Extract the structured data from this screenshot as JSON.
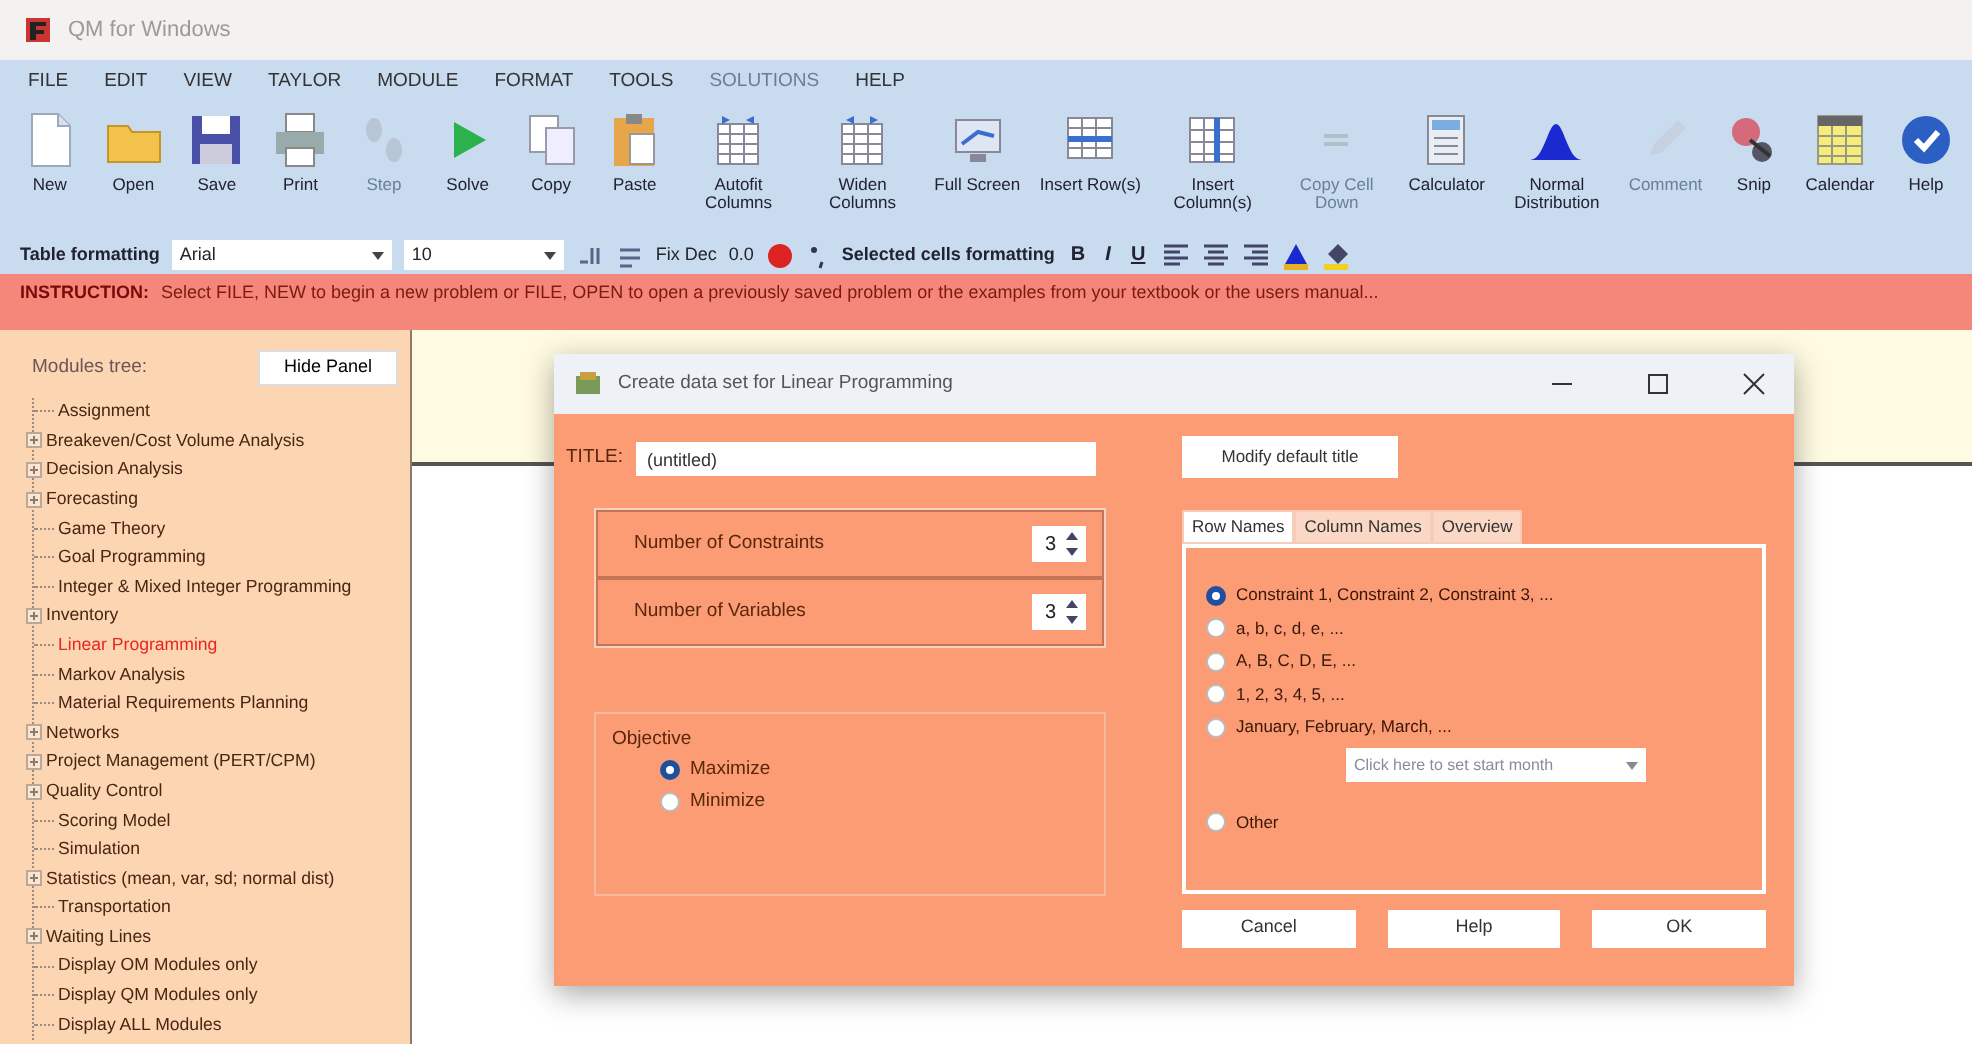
{
  "window": {
    "title": "QM for Windows"
  },
  "menu": [
    {
      "label": "FILE",
      "disabled": false
    },
    {
      "label": "EDIT",
      "disabled": false
    },
    {
      "label": "VIEW",
      "disabled": false
    },
    {
      "label": "TAYLOR",
      "disabled": false
    },
    {
      "label": "MODULE",
      "disabled": false
    },
    {
      "label": "FORMAT",
      "disabled": false
    },
    {
      "label": "TOOLS",
      "disabled": false
    },
    {
      "label": "SOLUTIONS",
      "disabled": true
    },
    {
      "label": "HELP",
      "disabled": false
    }
  ],
  "toolbar": [
    {
      "label": "New",
      "disabled": false
    },
    {
      "label": "Open",
      "disabled": false
    },
    {
      "label": "Save",
      "disabled": false
    },
    {
      "label": "Print",
      "disabled": false
    },
    {
      "label": "Step",
      "disabled": true
    },
    {
      "label": "Solve",
      "disabled": false
    },
    {
      "label": "Copy",
      "disabled": false
    },
    {
      "label": "Paste",
      "disabled": false
    },
    {
      "label": "Autofit Columns",
      "disabled": false
    },
    {
      "label": "Widen Columns",
      "disabled": false
    },
    {
      "label": "Full Screen",
      "disabled": false
    },
    {
      "label": "Insert Row(s)",
      "disabled": false
    },
    {
      "label": "Insert Column(s)",
      "disabled": false
    },
    {
      "label": "Copy Cell Down",
      "disabled": true
    },
    {
      "label": "Calculator",
      "disabled": false
    },
    {
      "label": "Normal Distribution",
      "disabled": false
    },
    {
      "label": "Comment",
      "disabled": true
    },
    {
      "label": "Snip",
      "disabled": false
    },
    {
      "label": "Calendar",
      "disabled": false
    },
    {
      "label": "Help",
      "disabled": false
    }
  ],
  "format_bar": {
    "label": "Table formatting",
    "font": "Arial",
    "size": "10",
    "fix_dec": "Fix Dec",
    "decimals": "0.0",
    "selected_label": "Selected cells formatting",
    "bold": "B",
    "italic": "I",
    "underline": "U"
  },
  "instruction": {
    "label": "INSTRUCTION:",
    "text": "Select FILE, NEW to begin a new problem or FILE, OPEN to open a previously saved problem or the examples from your textbook or the users manual..."
  },
  "modules_panel": {
    "label": "Modules tree:",
    "hide_button": "Hide Panel",
    "items": [
      {
        "label": "Assignment",
        "kind": "leaf",
        "selected": false
      },
      {
        "label": "Breakeven/Cost Volume Analysis",
        "kind": "group",
        "selected": false
      },
      {
        "label": "Decision Analysis",
        "kind": "group",
        "selected": false
      },
      {
        "label": "Forecasting",
        "kind": "group",
        "selected": false
      },
      {
        "label": "Game Theory",
        "kind": "leaf",
        "selected": false
      },
      {
        "label": "Goal Programming",
        "kind": "leaf",
        "selected": false
      },
      {
        "label": "Integer & Mixed Integer Programming",
        "kind": "leaf",
        "selected": false
      },
      {
        "label": "Inventory",
        "kind": "group",
        "selected": false
      },
      {
        "label": "Linear Programming",
        "kind": "leaf",
        "selected": true
      },
      {
        "label": "Markov Analysis",
        "kind": "leaf",
        "selected": false
      },
      {
        "label": "Material Requirements Planning",
        "kind": "leaf",
        "selected": false
      },
      {
        "label": "Networks",
        "kind": "group",
        "selected": false
      },
      {
        "label": "Project Management (PERT/CPM)",
        "kind": "group",
        "selected": false
      },
      {
        "label": "Quality Control",
        "kind": "group",
        "selected": false
      },
      {
        "label": "Scoring Model",
        "kind": "leaf",
        "selected": false
      },
      {
        "label": "Simulation",
        "kind": "leaf",
        "selected": false
      },
      {
        "label": "Statistics (mean, var, sd; normal dist)",
        "kind": "group",
        "selected": false
      },
      {
        "label": "Transportation",
        "kind": "leaf",
        "selected": false
      },
      {
        "label": "Waiting Lines",
        "kind": "group",
        "selected": false
      },
      {
        "label": "Display OM Modules only",
        "kind": "leaf",
        "selected": false
      },
      {
        "label": "Display QM Modules only",
        "kind": "leaf",
        "selected": false
      },
      {
        "label": "Display ALL Modules",
        "kind": "leaf",
        "selected": false
      }
    ]
  },
  "dialog": {
    "title": "Create data set for Linear Programming",
    "title_label": "TITLE:",
    "title_value": "(untitled)",
    "modify_button": "Modify default title",
    "spinners": [
      {
        "label": "Number of Constraints",
        "value": "3"
      },
      {
        "label": "Number of Variables",
        "value": "3"
      }
    ],
    "objective": {
      "label": "Objective",
      "options": [
        {
          "label": "Maximize",
          "selected": true
        },
        {
          "label": "Minimize",
          "selected": false
        }
      ]
    },
    "tabs": [
      {
        "label": "Row Names",
        "selected": true
      },
      {
        "label": "Column Names",
        "selected": false
      },
      {
        "label": "Overview",
        "selected": false
      }
    ],
    "row_names": [
      {
        "label": "Constraint 1, Constraint 2, Constraint 3, ...",
        "selected": true
      },
      {
        "label": "a, b, c, d, e, ...",
        "selected": false
      },
      {
        "label": "A, B, C, D, E, ...",
        "selected": false
      },
      {
        "label": "1, 2, 3, 4, 5, ...",
        "selected": false
      },
      {
        "label": "January, February, March, ...",
        "selected": false
      },
      {
        "label": "Other",
        "selected": false
      }
    ],
    "month_dropdown": {
      "placeholder": "Click here to set start month"
    },
    "buttons": [
      "Cancel",
      "Help",
      "OK"
    ]
  }
}
